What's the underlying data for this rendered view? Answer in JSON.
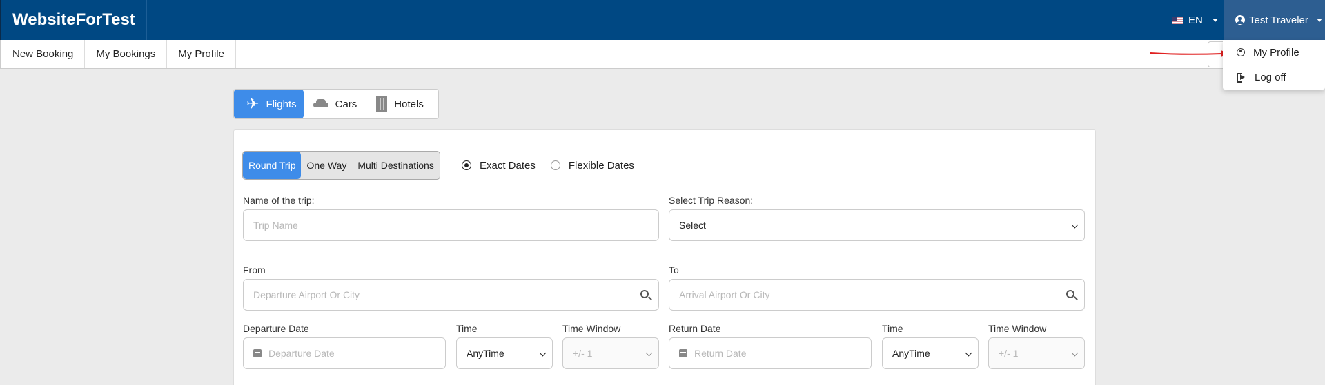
{
  "header": {
    "brand": "WebsiteForTest",
    "language": "EN",
    "user_name": "Test Traveler"
  },
  "subnav": {
    "items": [
      "New Booking",
      "My Bookings",
      "My Profile"
    ]
  },
  "user_menu": {
    "items": [
      {
        "label": "My Profile",
        "icon": "user-circle-icon"
      },
      {
        "label": "Log off",
        "icon": "log-off-icon"
      }
    ]
  },
  "product_tabs": [
    {
      "label": "Flights",
      "icon": "plane-icon",
      "active": true
    },
    {
      "label": "Cars",
      "icon": "car-icon",
      "active": false
    },
    {
      "label": "Hotels",
      "icon": "hotel-icon",
      "active": false
    }
  ],
  "trip_types": [
    {
      "label": "Round Trip",
      "active": true
    },
    {
      "label": "One Way",
      "active": false
    },
    {
      "label": "Multi Destinations",
      "active": false
    }
  ],
  "date_modes": [
    {
      "label": "Exact Dates",
      "checked": true
    },
    {
      "label": "Flexible Dates",
      "checked": false
    }
  ],
  "form": {
    "trip_name_label": "Name of the trip:",
    "trip_name_placeholder": "Trip Name",
    "trip_reason_label": "Select Trip Reason:",
    "trip_reason_value": "Select",
    "from_label": "From",
    "from_placeholder": "Departure Airport Or City",
    "to_label": "To",
    "to_placeholder": "Arrival Airport Or City",
    "departure_date_label": "Departure Date",
    "departure_date_placeholder": "Departure Date",
    "departure_time_label": "Time",
    "departure_time_value": "AnyTime",
    "departure_window_label": "Time Window",
    "departure_window_value": "+/- 1",
    "return_date_label": "Return Date",
    "return_date_placeholder": "Return Date",
    "return_time_label": "Time",
    "return_time_value": "AnyTime",
    "return_window_label": "Time Window",
    "return_window_value": "+/- 1"
  },
  "colors": {
    "header_bg": "#004883",
    "accent": "#3e8ce9",
    "annotation_arrow": "#e02020"
  }
}
